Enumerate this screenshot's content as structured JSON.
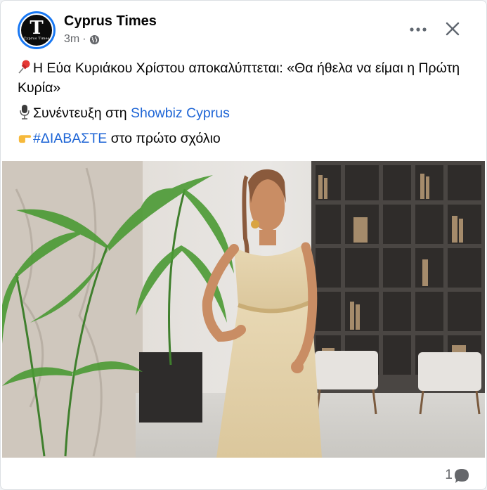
{
  "post": {
    "page_name": "Cyprus Times",
    "avatar_letter": "T",
    "avatar_subtext": "Cyprus Times",
    "timestamp": "3m",
    "separator": "·",
    "privacy_icon": "globe-icon",
    "more_label": "•••",
    "close_icon": "close-icon"
  },
  "body": {
    "line1_text": "Η Εύα Κυριάκου Χρίστου αποκαλύπτεται: «Θα ήθελα να είμαι η Πρώτη Κυρία»",
    "line1_emoji": "pushpin-emoji",
    "line2_text": "Συνέντευξη στη ",
    "line2_link": "Showbiz Cyprus",
    "line2_emoji": "microphone-emoji",
    "line3_hashtag": "#ΔΙΑΒΑΣΤΕ",
    "line3_text": " στο πρώτο σχόλιο",
    "line3_emoji": "pointing-hand-emoji"
  },
  "photo": {
    "subject": "woman-in-gold-dress-photo"
  },
  "footer": {
    "comment_count": "1",
    "comment_icon": "comment-bubble-icon"
  },
  "colors": {
    "link": "#1f66d6",
    "text": "#050505",
    "secondary": "#65676b",
    "avatar_ring": "#1877f2"
  }
}
